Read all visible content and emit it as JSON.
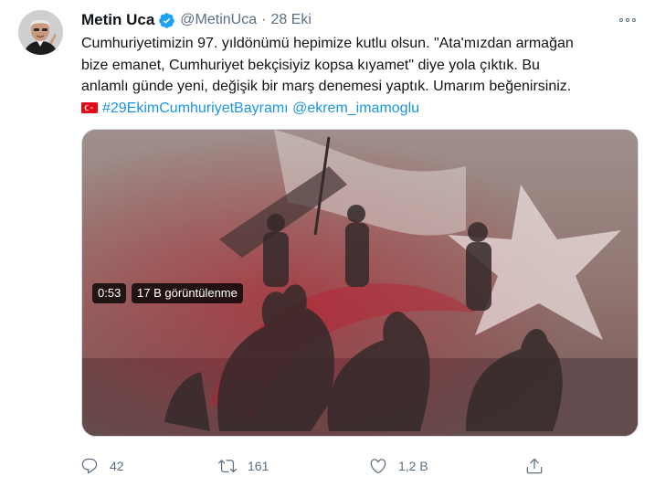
{
  "tweet": {
    "author_name": "Metin Uca",
    "handle": "@MetinUca",
    "separator": "·",
    "time": "28 Eki",
    "text_lines": [
      "Cumhuriyetimizin 97. yıldönümü hepimize kutlu olsun. \"Ata'mızdan armağan",
      "bize emanet, Cumhuriyet bekçisiyiz kopsa kıyamet\" diye yola çıktık. Bu",
      "anlamlı günde yeni, değişik bir marş denemesi yaptık. Umarım beğenirsiniz."
    ],
    "hashtag": "#29EkimCumhuriyetBayramı",
    "mention": "@ekrem_imamoglu",
    "media": {
      "duration": "0:53",
      "views": "17 B görüntülenme"
    },
    "actions": {
      "reply_count": "42",
      "retweet_count": "161",
      "like_count": "1,2 B"
    }
  },
  "icons": {
    "verified": "verified-badge-icon",
    "more": "more-dots-icon",
    "reply": "reply-icon",
    "retweet": "retweet-icon",
    "like": "heart-icon",
    "share": "share-icon",
    "flag": "turkey-flag-icon"
  },
  "colors": {
    "link": "#1b95e0",
    "secondary_text": "#5b7083",
    "verified": "#1da1f2",
    "flag_red": "#e30a17"
  }
}
